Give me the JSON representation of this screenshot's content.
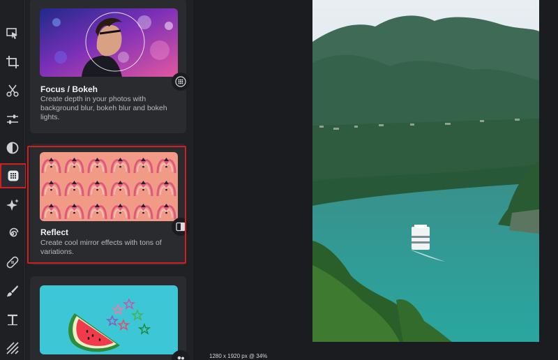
{
  "effects": [
    {
      "title": "Focus / Bokeh",
      "description": "Create depth in your photos with background blur, bokeh blur and bokeh lights."
    },
    {
      "title": "Reflect",
      "description": "Create cool mirror effects with tons of variations."
    },
    {
      "title": "",
      "description": ""
    }
  ],
  "tools": [
    "select-icon",
    "crop-icon",
    "cut-icon",
    "adjust-sliders-icon",
    "contrast-icon",
    "effects-icon",
    "sparkle-icon",
    "spiral-icon",
    "bandage-icon",
    "brush-icon",
    "text-icon",
    "texture-icon"
  ],
  "canvas": {
    "status_text": "1280 x 1920 px @ 34%"
  },
  "colors": {
    "selection": "#d11f1f",
    "panel": "#202125",
    "card": "#2a2b2f"
  }
}
